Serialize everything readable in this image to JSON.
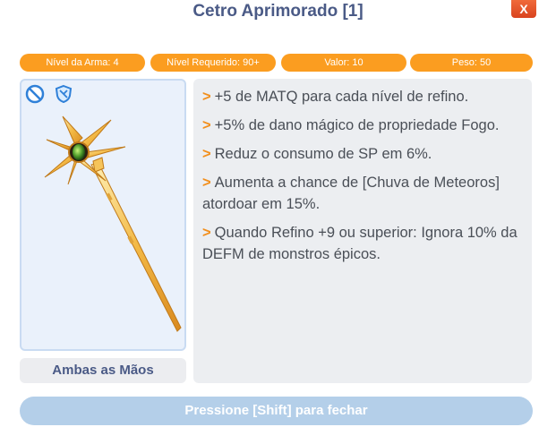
{
  "window": {
    "title": "Cetro Aprimorado [1]",
    "close_label": "X"
  },
  "badges": [
    {
      "label": "Nível da Arma: 4"
    },
    {
      "label": "Nível Requerido: 90+"
    },
    {
      "label": "Valor: 10"
    },
    {
      "label": "Peso: 50"
    }
  ],
  "item": {
    "icons": [
      "no-trade-icon",
      "protected-shield-icon"
    ],
    "hands_label": "Ambas as Mãos"
  },
  "description": {
    "bullet": ">",
    "lines": [
      "+5 de MATQ para cada nível de refino.",
      "+5% de dano mágico de propriedade Fogo.",
      "Reduz o consumo de SP em 6%.",
      "Aumenta a chance de [Chuva de Meteoros] atordoar em 15%.",
      "Quando Refino +9 ou superior: Ignora 10% da DEFM de monstros épicos."
    ]
  },
  "footer": {
    "close_hint": "Pressione [Shift] para fechar"
  },
  "colors": {
    "title": "#4a5a86",
    "badge": "#fb9d20",
    "bullet": "#f28f1c",
    "footer_button": "#b4cfe9",
    "close_button": "#e2512a"
  }
}
